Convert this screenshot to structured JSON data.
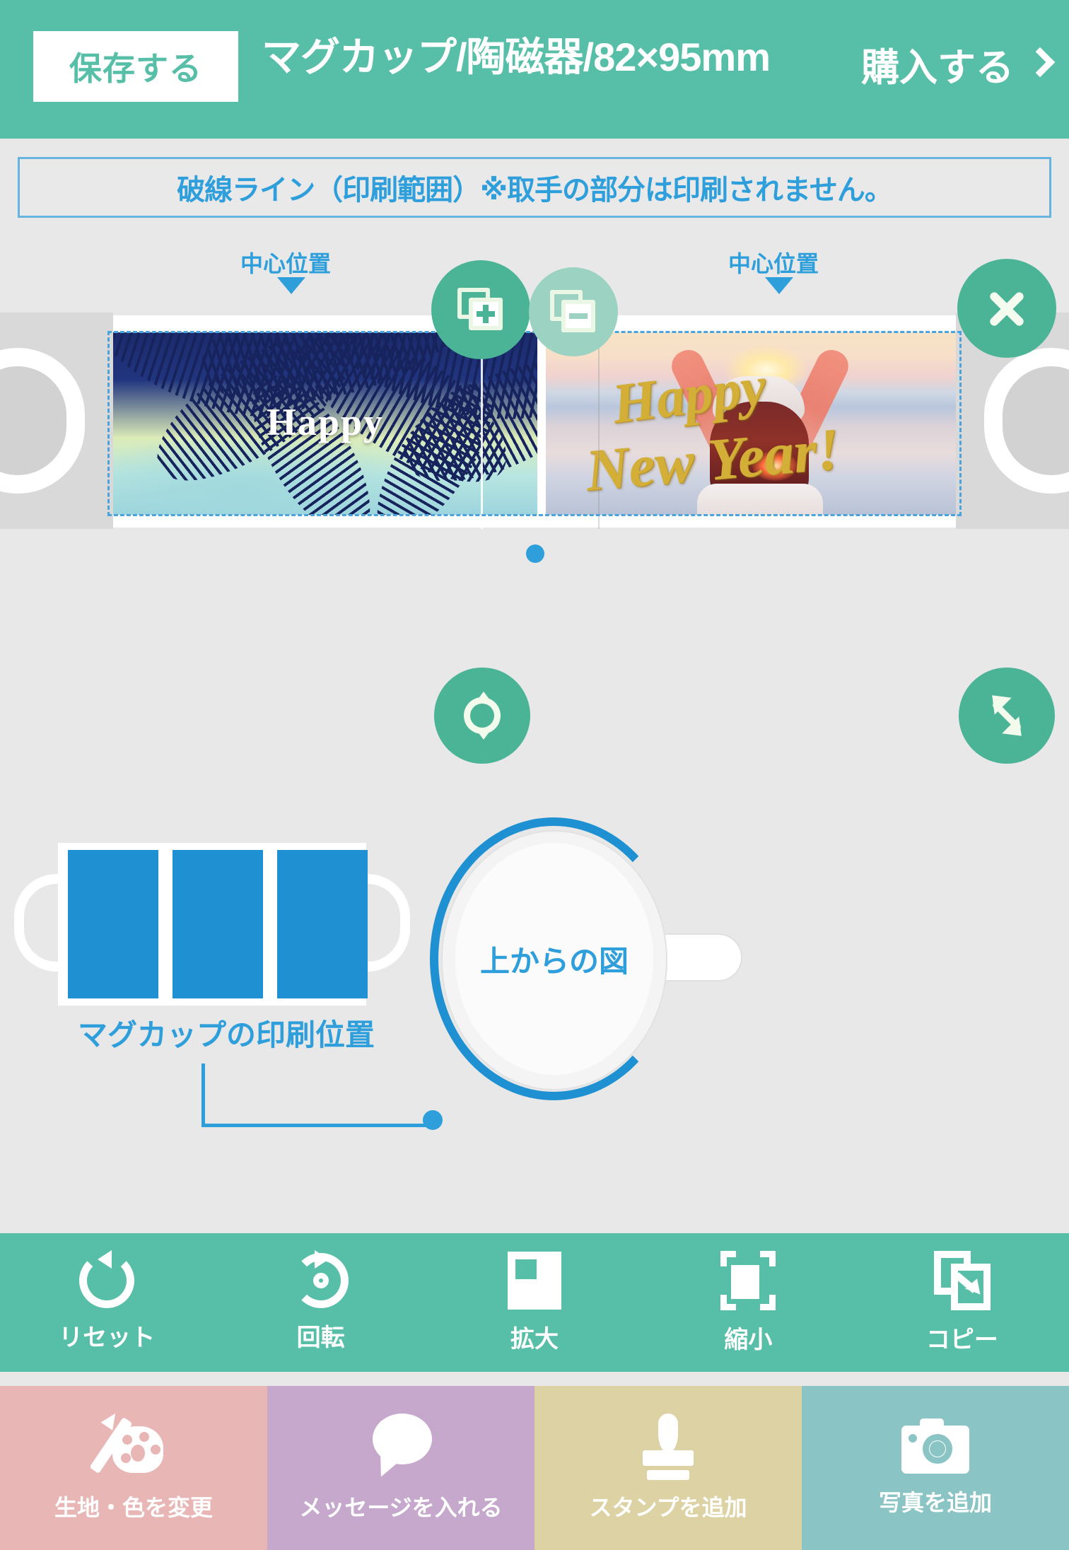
{
  "header": {
    "save_label": "保存する",
    "title": "マグカップ/陶磁器/82×95mm",
    "purchase_label": "購入する",
    "accent_color": "#57bfa8"
  },
  "notice": {
    "text": "破線ライン（印刷範囲）※取手の部分は印刷されません。",
    "border_color": "#68b4e0",
    "text_color": "#2f9fdc"
  },
  "canvas": {
    "center_label_left": "中心位置",
    "center_label_right": "中心位置",
    "photo_left": {
      "caption": "Happy"
    },
    "photo_right": {
      "caption_line1": "Happy",
      "caption_line2": "New Year!"
    },
    "fabs": [
      {
        "name": "layer-add",
        "icon": "layer-plus-icon",
        "state": "enabled"
      },
      {
        "name": "layer-remove",
        "icon": "layer-minus-icon",
        "state": "disabled"
      },
      {
        "name": "close",
        "icon": "close-icon",
        "state": "enabled"
      },
      {
        "name": "rotate",
        "icon": "refresh-icon",
        "state": "enabled"
      },
      {
        "name": "resize",
        "icon": "resize-diagonal-icon",
        "state": "enabled"
      }
    ]
  },
  "diagram": {
    "print_position_label": "マグカップの印刷位置",
    "top_view_label": "上からの図",
    "print_rect_color": "#1f91d2",
    "line_color": "#2f9fdc"
  },
  "toolbar": {
    "items": [
      {
        "label": "リセット",
        "icon": "reset-icon"
      },
      {
        "label": "回転",
        "icon": "rotate-icon"
      },
      {
        "label": "拡大",
        "icon": "enlarge-icon"
      },
      {
        "label": "縮小",
        "icon": "shrink-icon"
      },
      {
        "label": "コピー",
        "icon": "copy-icon"
      }
    ]
  },
  "bottom_actions": {
    "items": [
      {
        "label": "生地・色を変更",
        "icon": "palette-icon",
        "color": "#e9b6b6"
      },
      {
        "label": "メッセージを入れる",
        "icon": "speech-bubble-icon",
        "color": "#c6a8cd"
      },
      {
        "label": "スタンプを追加",
        "icon": "stamp-icon",
        "color": "#ddd2a4"
      },
      {
        "label": "写真を追加",
        "icon": "camera-icon",
        "color": "#8bc4c4"
      }
    ]
  }
}
